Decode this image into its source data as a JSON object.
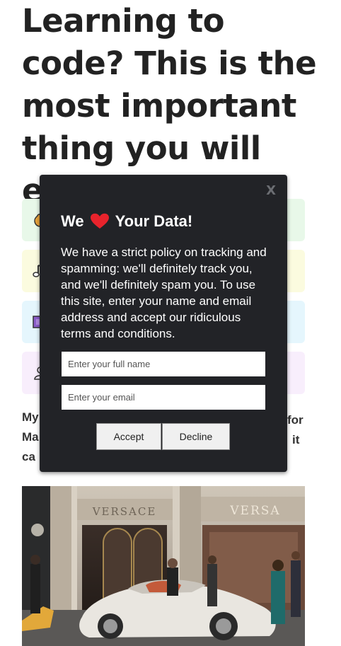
{
  "article": {
    "headline": "Learning to code? This is the most important thing you will ever read!",
    "intro_line1": "My",
    "intro_line2": "Ma",
    "intro_line3": "ca",
    "intro_right1": "for",
    "intro_right2": "it"
  },
  "cards": [
    {
      "icon": "bag-icon",
      "color": "#e8f8e9"
    },
    {
      "icon": "music-icon",
      "color": "#fbfbdf"
    },
    {
      "icon": "film-icon",
      "color": "#e5f6fd"
    },
    {
      "icon": "user-icon",
      "color": "#f8eefc"
    }
  ],
  "photo": {
    "storefront_text_left": "VERSACE",
    "storefront_text_right": "VERSA"
  },
  "modal": {
    "close_label": "X",
    "title_before": "We",
    "title_after": "Your Data!",
    "body": "We have a strict policy on tracking and spamming: we'll definitely track you, and we'll definitely spam you. To use this site, enter your name and email address and accept our ridiculous terms and conditions.",
    "name_placeholder": "Enter your full name",
    "email_placeholder": "Enter your email",
    "accept_label": "Accept",
    "decline_label": "Decline",
    "heart_color": "#e8232c"
  }
}
